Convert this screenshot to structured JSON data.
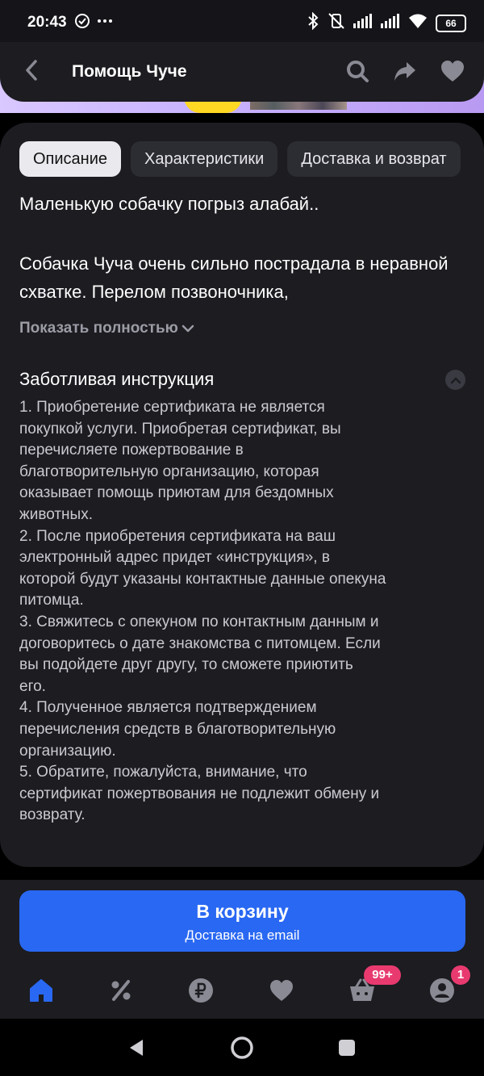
{
  "status_bar": {
    "time": "20:43",
    "battery": "66",
    "icons": [
      "sync-icon",
      "more-icon",
      "bluetooth-icon",
      "vibrate-off-icon",
      "signal-icon",
      "signal-icon",
      "wifi-icon",
      "battery-icon"
    ]
  },
  "header": {
    "title": "Помощь Чуче",
    "icons": [
      "back-icon",
      "search-icon",
      "share-icon",
      "heart-icon"
    ]
  },
  "tabs": [
    {
      "label": "Описание",
      "active": true
    },
    {
      "label": "Характеристики",
      "active": false
    },
    {
      "label": "Доставка и возврат",
      "active": false
    }
  ],
  "description": {
    "paragraph1": "Маленькую собачку погрыз алабай..",
    "paragraph2": "Собачка Чуча очень сильно пострадала в неравной схватке. Перелом позвоночника,",
    "show_more": "Показать полностью"
  },
  "instruction": {
    "title": "Заботливая инструкция",
    "lines": [
      "1. Приобретение сертификата не является",
      "покупкой услуги. Приобретая сертификат, вы",
      "перечисляете пожертвование в",
      "благотворительную организацию, которая",
      "оказывает помощь приютам для бездомных",
      "животных.",
      "2. После приобретения сертификата на ваш",
      "электронный адрес придет «инструкция», в",
      "которой будут указаны контактные данные опекуна",
      "питомца.",
      "3. Свяжитесь с опекуном по контактным данным и",
      "договоритесь о дате знакомства с питомцем. Если",
      "вы подойдете друг другу, то сможете приютить",
      "его.",
      "4. Полученное является подтверждением",
      "перечисления средств в благотворительную",
      "организацию.",
      "5. Обратите, пожалуйста, внимание, что",
      "сертификат пожертвования не подлежит обмену и",
      "возврату."
    ]
  },
  "cart_button": {
    "label": "В корзину",
    "sublabel": "Доставка на email"
  },
  "bottom_nav": {
    "items": [
      "home-icon",
      "discount-icon",
      "ruble-icon",
      "heart-icon",
      "cart-icon",
      "profile-icon"
    ],
    "cart_badge": "99+",
    "profile_badge": "1"
  },
  "colors": {
    "accent": "#2968f2",
    "card_bg": "#1c1c21",
    "badge": "#e83a6f"
  }
}
